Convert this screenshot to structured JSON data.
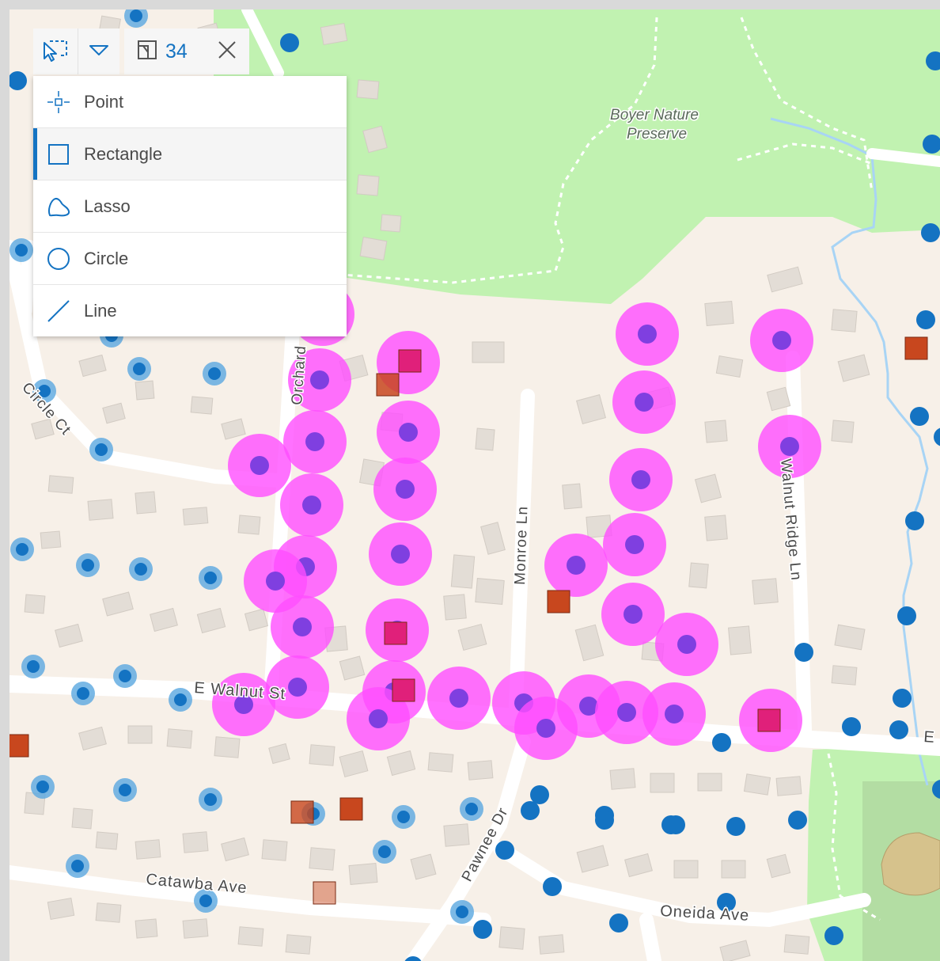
{
  "colors": {
    "land": "#f7f0e8",
    "park": "#c1f2b1",
    "road": "#ffffff",
    "building": "#e3ddd6",
    "stream": "#a8d4f5",
    "point_blue": "#1473c2",
    "halo_blue": "#5aa7e0",
    "selected_halo": "#ff4dff",
    "selected_core": "#7f3fe0",
    "square_orange": "#c8471e",
    "square_pink": "#e0207a",
    "accent": "#1473c2"
  },
  "toolbar": {
    "select_icon": "select-tool-icon",
    "dropdown_icon": "triangle-down-icon",
    "selection_icon": "selection-set-icon",
    "selection_count": "34",
    "close_icon": "close-icon"
  },
  "menu": {
    "items": [
      {
        "label": "Point",
        "icon": "point-icon",
        "active": false
      },
      {
        "label": "Rectangle",
        "icon": "rectangle-icon",
        "active": true
      },
      {
        "label": "Lasso",
        "icon": "lasso-icon",
        "active": false
      },
      {
        "label": "Circle",
        "icon": "circle-icon",
        "active": false
      },
      {
        "label": "Line",
        "icon": "line-icon",
        "active": false
      }
    ]
  },
  "map": {
    "labels": {
      "boyer_1": "Boyer Nature",
      "boyer_2": "Preserve",
      "circle_ct": "Circle Ct",
      "orchard": "Orchard",
      "monroe": "Monroe Ln",
      "walnut_ridge": "Walnut Ridge Ln",
      "e_walnut": "E Walnut St",
      "e_right": "E",
      "pawnee": "Pawnee Dr",
      "catawba": "Catawba Ave",
      "oneida": "Oneida Ave"
    }
  }
}
